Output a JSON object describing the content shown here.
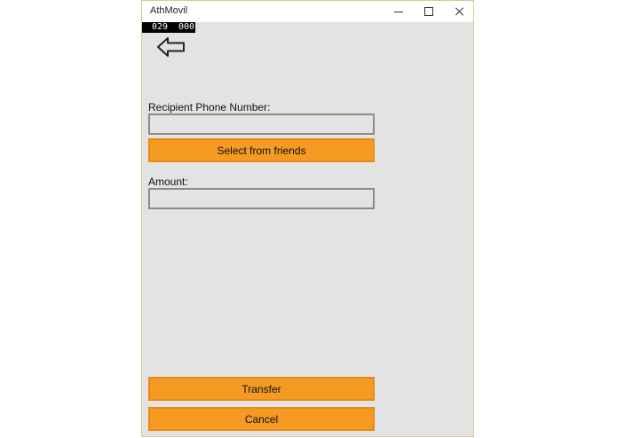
{
  "window": {
    "title": "AthMovil"
  },
  "frame_counter": {
    "left": "029",
    "right": "000"
  },
  "form": {
    "recipient_label": "Recipient Phone Number:",
    "recipient_value": "",
    "select_friends_label": "Select from friends",
    "amount_label": "Amount:",
    "amount_value": ""
  },
  "actions": {
    "transfer_label": "Transfer",
    "cancel_label": "Cancel"
  },
  "icons": {
    "back": "arrow-left-icon",
    "minimize": "minimize-icon",
    "maximize": "maximize-icon",
    "close": "close-icon"
  },
  "colors": {
    "accent": "#f59a23",
    "background": "#e3e3e3"
  }
}
